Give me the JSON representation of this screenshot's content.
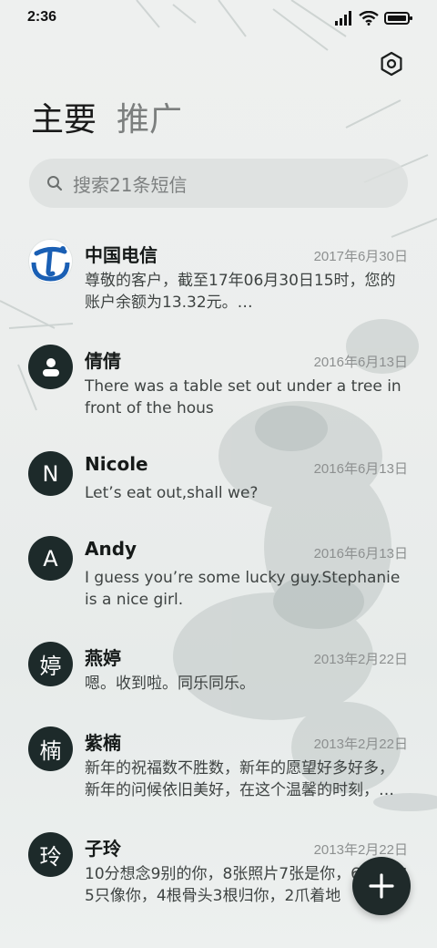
{
  "status_bar": {
    "time": "2:36",
    "icons": [
      "signal-icon",
      "wifi-icon",
      "battery-icon"
    ]
  },
  "header": {
    "settings_icon": "settings-hexagon-icon",
    "tabs": [
      {
        "label": "主要",
        "active": true
      },
      {
        "label": "推广",
        "active": false
      }
    ]
  },
  "search": {
    "placeholder": "搜索21条短信"
  },
  "conversations": [
    {
      "avatar_type": "logo",
      "avatar_text": "",
      "name": "中国电信",
      "date": "2017年6月30日",
      "message": "尊敬的客户，截至17年06月30日15时，您的账户余额为13.32元。…"
    },
    {
      "avatar_type": "person-icon",
      "avatar_text": "",
      "name": "倩倩",
      "date": "2016年6月13日",
      "message": "There was a table set out under a tree in front of the hous"
    },
    {
      "avatar_type": "letter",
      "avatar_text": "N",
      "name": "Nicole",
      "date": "2016年6月13日",
      "message": "Let’s eat out,shall we?"
    },
    {
      "avatar_type": "letter",
      "avatar_text": "A",
      "name": "Andy",
      "date": "2016年6月13日",
      "message": "I guess you’re some lucky guy.Stephanie is a nice girl."
    },
    {
      "avatar_type": "letter",
      "avatar_text": "婷",
      "name": "燕婷",
      "date": "2013年2月22日",
      "message": "嗯。收到啦。同乐同乐。"
    },
    {
      "avatar_type": "letter",
      "avatar_text": "楠",
      "name": "紫楠",
      "date": "2013年2月22日",
      "message": "新年的祝福数不胜数，新年的愿望好多好多，新年的问候依旧美好，在这个温馨的时刻，…"
    },
    {
      "avatar_type": "letter",
      "avatar_text": "玲",
      "name": "子玲",
      "date": "2013年2月22日",
      "message": "10分想念9别的你，8张照片7张是你，6只小狗5只像你，4根骨头3根归你，2爪着地"
    }
  ],
  "fab": {
    "icon": "plus-icon"
  },
  "colors": {
    "avatar_bg": "#1d2a2a",
    "fab_bg": "#1f2a2a",
    "telecom_blue": "#1a5fb4",
    "background": "#eceeed"
  }
}
